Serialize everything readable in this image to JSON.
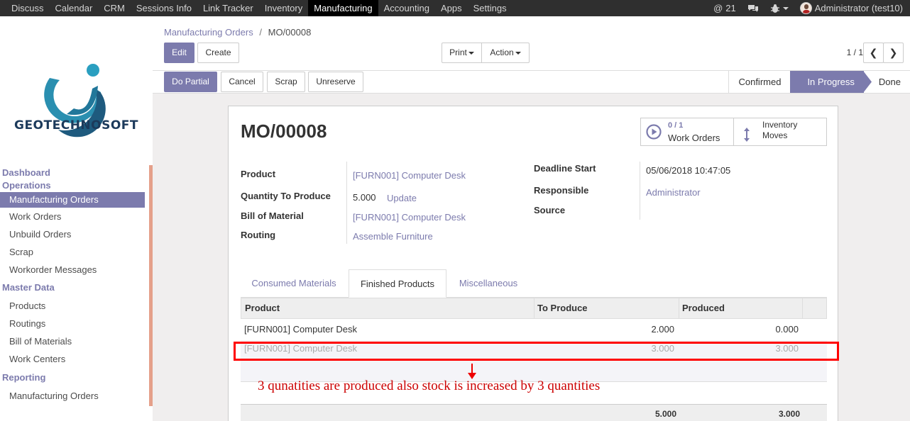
{
  "topbar": {
    "menu": [
      "Discuss",
      "Calendar",
      "CRM",
      "Sessions Info",
      "Link Tracker",
      "Inventory",
      "Manufacturing",
      "Accounting",
      "Apps",
      "Settings"
    ],
    "active": "Manufacturing",
    "messages_count": "21",
    "user": "Administrator (test10)"
  },
  "logo": {
    "text": "GEOTECHNOSOFT"
  },
  "sidebar": {
    "sections": [
      {
        "header": "Dashboard",
        "items": []
      },
      {
        "header": "Operations",
        "items": [
          "Manufacturing Orders",
          "Work Orders",
          "Unbuild Orders",
          "Scrap",
          "Workorder Messages"
        ]
      },
      {
        "header": "Master Data",
        "items": [
          "Products",
          "Routings",
          "Bill of Materials",
          "Work Centers"
        ]
      },
      {
        "header": "Reporting",
        "items": [
          "Manufacturing Orders"
        ]
      }
    ],
    "selected": "Manufacturing Orders"
  },
  "breadcrumb": {
    "parent": "Manufacturing Orders",
    "current": "MO/00008"
  },
  "buttons": {
    "edit": "Edit",
    "create": "Create",
    "print": "Print",
    "action": "Action",
    "do_partial": "Do Partial",
    "cancel": "Cancel",
    "scrap": "Scrap",
    "unreserve": "Unreserve"
  },
  "pager": "1 / 1",
  "statusbar": {
    "steps": [
      "Confirmed",
      "In Progress",
      "Done"
    ],
    "current": "In Progress"
  },
  "record": {
    "name": "MO/00008",
    "smart_buttons": {
      "work_orders_count": "0 / 1",
      "work_orders_label": "Work Orders",
      "inventory_label_1": "Inventory",
      "inventory_label_2": "Moves"
    },
    "fields": {
      "product_label": "Product",
      "product": "[FURN001] Computer Desk",
      "qty_label": "Quantity To Produce",
      "qty": "5.000",
      "update": "Update",
      "bom_label": "Bill of Material",
      "bom": "[FURN001] Computer Desk",
      "routing_label": "Routing",
      "routing": "Assemble Furniture",
      "deadline_label": "Deadline Start",
      "deadline": "05/06/2018 10:47:05",
      "responsible_label": "Responsible",
      "responsible": "Administrator",
      "source_label": "Source"
    }
  },
  "tabs": [
    "Consumed Materials",
    "Finished Products",
    "Miscellaneous"
  ],
  "active_tab": "Finished Products",
  "table": {
    "columns": [
      "Product",
      "To Produce",
      "Produced"
    ],
    "rows": [
      {
        "product": "[FURN001] Computer Desk",
        "to_produce": "2.000",
        "produced": "0.000"
      },
      {
        "product": "[FURN001] Computer Desk",
        "to_produce": "3.000",
        "produced": "3.000"
      }
    ],
    "totals": {
      "to_produce": "5.000",
      "produced": "3.000"
    }
  },
  "annotation": "3 qunatities are produced also stock is increased by 3 quantities",
  "colors": {
    "primary": "#7c7bad",
    "annotation": "#cc0000"
  }
}
